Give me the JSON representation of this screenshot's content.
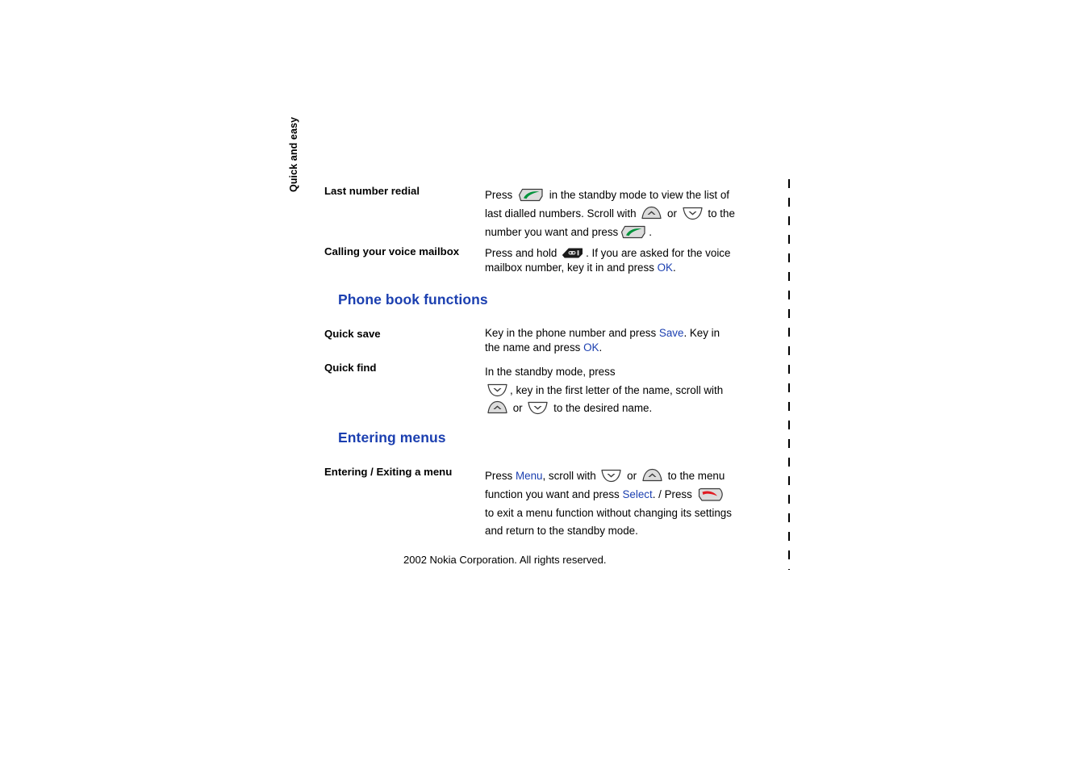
{
  "page": {
    "side_tab": "Quick and easy",
    "footer": "2002 Nokia Corporation. All rights reserved.",
    "accent_color": "#1b3fb0",
    "icon_green": "#00933b",
    "icon_red": "#e11b22",
    "icon_body": "#d9d9d9",
    "background": "#ffffff"
  },
  "entries": {
    "last_number_redial": {
      "label": "Last number redial",
      "text_1": "Press",
      "icon_1": "call-key-icon",
      "text_2": "in the standby mode to view the list of last dialled numbers. Scroll with",
      "icon_2": "scroll-up-key-icon",
      "text_3": "or",
      "icon_3": "scroll-down-key-icon",
      "text_4": "to the number you want and press",
      "icon_4": "call-key-icon",
      "text_5": "."
    },
    "voice_mailbox": {
      "label": "Calling your voice mailbox",
      "text_1": "Press and hold",
      "icon_1": "voicemail-key-icon",
      "text_2": ". If you are asked for the voice mailbox number, key it in and press",
      "link_1": "OK",
      "text_3": "."
    },
    "quick_save": {
      "label": "Quick save",
      "text_1": "Key in the phone number and press",
      "link_1": "Save",
      "text_2": ". Key in the name and press",
      "link_2": "OK",
      "text_3": "."
    },
    "quick_find": {
      "label": "Quick find",
      "text_1": "In the standby mode, press",
      "icon_1": "scroll-down-key-icon",
      "text_2": ", key in the first letter of the name, scroll with",
      "icon_2": "scroll-up-key-icon",
      "text_3": "or",
      "icon_3": "scroll-down-key-icon",
      "text_4": "to the desired name."
    },
    "entering_exiting": {
      "label": "Entering /  Exiting a menu",
      "text_1": "Press",
      "link_1": "Menu",
      "text_2": ", scroll with",
      "icon_1": "scroll-down-key-icon",
      "text_3": "or",
      "icon_2": "scroll-up-key-icon",
      "text_4": "to the menu function you want and press",
      "link_2": "Select",
      "text_5": ". / Press",
      "icon_3": "end-call-key-icon",
      "text_6": "to exit a menu function without changing its settings and return to the standby mode."
    }
  },
  "headings": {
    "phone_book": "Phone book functions",
    "entering_menus": "Entering menus"
  }
}
